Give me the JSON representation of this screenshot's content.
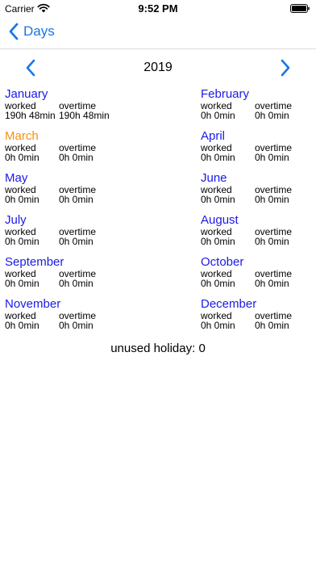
{
  "status_bar": {
    "carrier": "Carrier",
    "time": "9:52 PM"
  },
  "nav": {
    "back_label": "Days"
  },
  "year": "2019",
  "labels": {
    "worked": "worked",
    "overtime": "overtime"
  },
  "months": [
    {
      "name": "January",
      "worked": "190h 48min",
      "overtime": "190h 48min",
      "current": false
    },
    {
      "name": "February",
      "worked": "0h 0min",
      "overtime": "0h 0min",
      "current": false
    },
    {
      "name": "March",
      "worked": "0h 0min",
      "overtime": "0h 0min",
      "current": true
    },
    {
      "name": "April",
      "worked": "0h 0min",
      "overtime": "0h 0min",
      "current": false
    },
    {
      "name": "May",
      "worked": "0h 0min",
      "overtime": "0h 0min",
      "current": false
    },
    {
      "name": "June",
      "worked": "0h 0min",
      "overtime": "0h 0min",
      "current": false
    },
    {
      "name": "July",
      "worked": "0h 0min",
      "overtime": "0h 0min",
      "current": false
    },
    {
      "name": "August",
      "worked": "0h 0min",
      "overtime": "0h 0min",
      "current": false
    },
    {
      "name": "September",
      "worked": "0h 0min",
      "overtime": "0h 0min",
      "current": false
    },
    {
      "name": "October",
      "worked": "0h 0min",
      "overtime": "0h 0min",
      "current": false
    },
    {
      "name": "November",
      "worked": "0h 0min",
      "overtime": "0h 0min",
      "current": false
    },
    {
      "name": "December",
      "worked": "0h 0min",
      "overtime": "0h 0min",
      "current": false
    }
  ],
  "unused_holiday": "unused holiday: 0",
  "colors": {
    "accent": "#1976e8",
    "month_name": "#1a1ae6",
    "current_month": "#f2920f"
  }
}
